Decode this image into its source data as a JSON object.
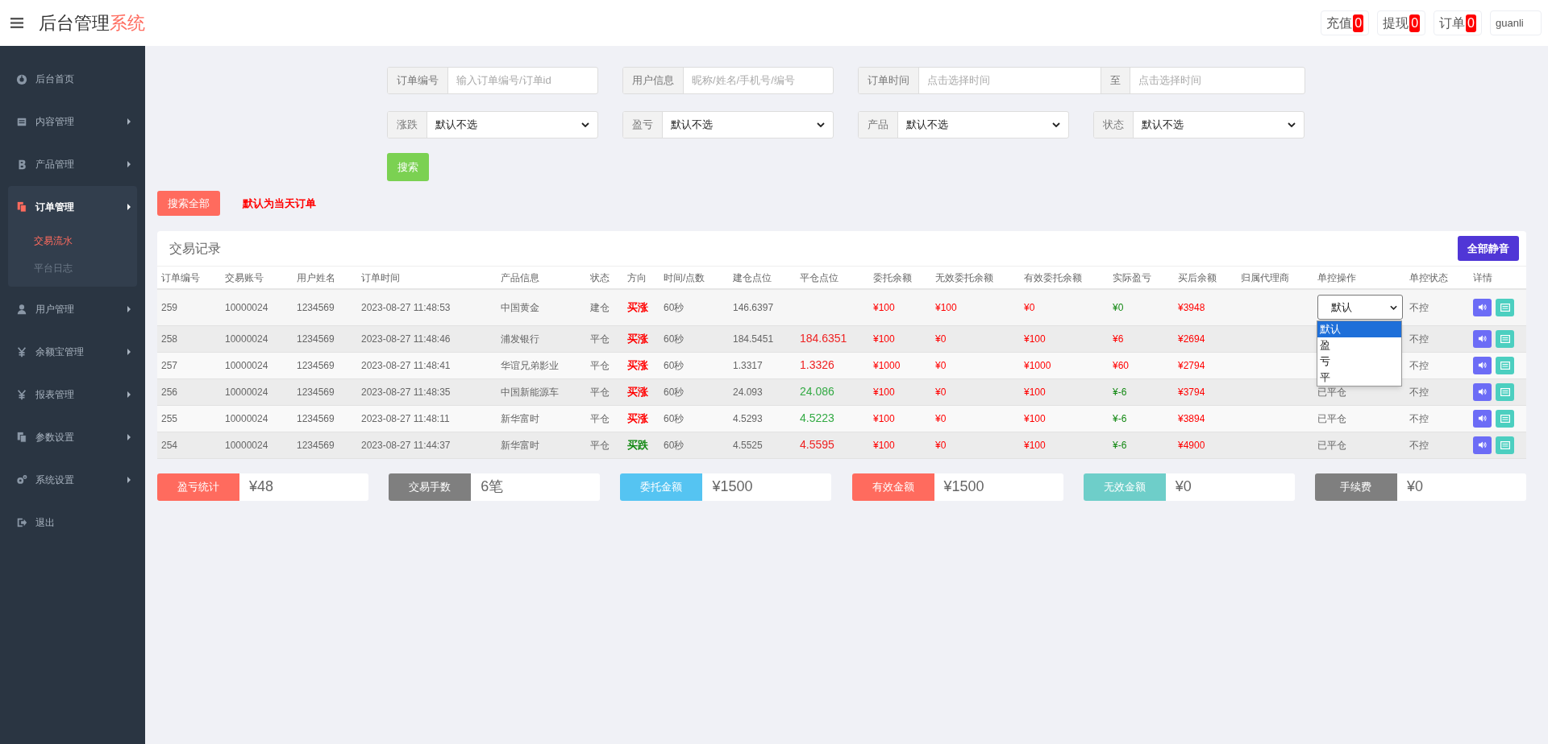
{
  "header": {
    "title": "后台管理",
    "title_accent": "系统",
    "badges": [
      {
        "label": "充值",
        "count": "0"
      },
      {
        "label": "提现",
        "count": "0"
      },
      {
        "label": "订单",
        "count": "0"
      }
    ],
    "user": "guanli"
  },
  "sidebar": {
    "items": [
      {
        "label": "后台首页",
        "expandable": false,
        "expanded": false
      },
      {
        "label": "内容管理",
        "expandable": true,
        "expanded": false
      },
      {
        "label": "产品管理",
        "expandable": true,
        "expanded": false
      },
      {
        "label": "订单管理",
        "expandable": true,
        "expanded": true,
        "children": [
          {
            "label": "交易流水",
            "selected": true
          },
          {
            "label": "平台日志",
            "selected": false
          }
        ]
      },
      {
        "label": "用户管理",
        "expandable": true,
        "expanded": false
      },
      {
        "label": "余额宝管理",
        "expandable": true,
        "expanded": false
      },
      {
        "label": "报表管理",
        "expandable": true,
        "expanded": false
      },
      {
        "label": "参数设置",
        "expandable": true,
        "expanded": false
      },
      {
        "label": "系统设置",
        "expandable": true,
        "expanded": false
      },
      {
        "label": "退出",
        "expandable": false,
        "expanded": false
      }
    ]
  },
  "filters": {
    "text_fields": [
      {
        "label": "订单编号",
        "placeholder": "输入订单编号/订单id"
      },
      {
        "label": "用户信息",
        "placeholder": "昵称/姓名/手机号/编号"
      },
      {
        "label": "订单时间",
        "placeholder": "点击选择时间",
        "separator": "至",
        "placeholder_end": "点击选择时间"
      }
    ],
    "selects": [
      {
        "label": "涨跌",
        "value": "默认不选"
      },
      {
        "label": "盈亏",
        "value": "默认不选"
      },
      {
        "label": "产品",
        "value": "默认不选"
      },
      {
        "label": "状态",
        "value": "默认不选"
      }
    ],
    "search_button": "搜索"
  },
  "search_all_button": "搜索全部",
  "note": "默认为当天订单",
  "table": {
    "title": "交易记录",
    "mute_all_button": "全部静音",
    "columns": [
      "订单编号",
      "交易账号",
      "用户姓名",
      "订单时间",
      "产品信息",
      "状态",
      "方向",
      "时间/点数",
      "建仓点位",
      "平仓点位",
      "委托余额",
      "无效委托余额",
      "有效委托余额",
      "实际盈亏",
      "买后余额",
      "归属代理商",
      "单控操作",
      "单控状态",
      "详情"
    ],
    "rows": [
      {
        "id": "259",
        "account": "10000024",
        "user": "1234569",
        "time": "2023-08-27 11:48:53",
        "product": "中国黄金",
        "status": "建仓",
        "direction": {
          "text": "买涨",
          "color": "#ff0000"
        },
        "duration": "60秒",
        "open_price": "146.6397",
        "entrust": "¥100",
        "invalid": "¥100",
        "valid": "¥0",
        "pnl": {
          "text": "¥0",
          "color": "#118811"
        },
        "balance": "¥3948",
        "control": {
          "kind": "select",
          "value": "默认"
        },
        "control_state": "不控"
      },
      {
        "id": "258",
        "account": "10000024",
        "user": "1234569",
        "time": "2023-08-27 11:48:46",
        "product": "浦发银行",
        "status": "平仓",
        "direction": {
          "text": "买涨",
          "color": "#ff0000"
        },
        "duration": "60秒",
        "open_price": "184.5451",
        "close_price": {
          "text": "184.6351",
          "color": "#ee2222"
        },
        "entrust": "¥100",
        "invalid": "¥0",
        "valid": "¥100",
        "pnl": {
          "text": "¥6",
          "color": "#ff0000"
        },
        "balance": "¥2694",
        "control_state": "不控"
      },
      {
        "id": "257",
        "account": "10000024",
        "user": "1234569",
        "time": "2023-08-27 11:48:41",
        "product": "华谊兄弟影业",
        "status": "平仓",
        "direction": {
          "text": "买涨",
          "color": "#ff0000"
        },
        "duration": "60秒",
        "open_price": "1.3317",
        "close_price": {
          "text": "1.3326",
          "color": "#ee2222"
        },
        "entrust": "¥1000",
        "invalid": "¥0",
        "valid": "¥1000",
        "pnl": {
          "text": "¥60",
          "color": "#ff0000"
        },
        "balance": "¥2794",
        "control_state": "不控"
      },
      {
        "id": "256",
        "account": "10000024",
        "user": "1234569",
        "time": "2023-08-27 11:48:35",
        "product": "中国新能源车",
        "status": "平仓",
        "direction": {
          "text": "买涨",
          "color": "#ff0000"
        },
        "duration": "60秒",
        "open_price": "24.093",
        "close_price": {
          "text": "24.086",
          "color": "#33aa44"
        },
        "entrust": "¥100",
        "invalid": "¥0",
        "valid": "¥100",
        "pnl": {
          "text": "¥-6",
          "color": "#118811"
        },
        "balance": "¥3794",
        "control": {
          "kind": "text",
          "text": "已平仓"
        },
        "control_state": "不控"
      },
      {
        "id": "255",
        "account": "10000024",
        "user": "1234569",
        "time": "2023-08-27 11:48:11",
        "product": "新华富时",
        "status": "平仓",
        "direction": {
          "text": "买涨",
          "color": "#ff0000"
        },
        "duration": "60秒",
        "open_price": "4.5293",
        "close_price": {
          "text": "4.5223",
          "color": "#33aa44"
        },
        "entrust": "¥100",
        "invalid": "¥0",
        "valid": "¥100",
        "pnl": {
          "text": "¥-6",
          "color": "#118811"
        },
        "balance": "¥3894",
        "control": {
          "kind": "text",
          "text": "已平仓"
        },
        "control_state": "不控"
      },
      {
        "id": "254",
        "account": "10000024",
        "user": "1234569",
        "time": "2023-08-27 11:44:37",
        "product": "新华富时",
        "status": "平仓",
        "direction": {
          "text": "买跌",
          "color": "#118811"
        },
        "duration": "60秒",
        "open_price": "4.5525",
        "close_price": {
          "text": "4.5595",
          "color": "#ee2222"
        },
        "entrust": "¥100",
        "invalid": "¥0",
        "valid": "¥100",
        "pnl": {
          "text": "¥-6",
          "color": "#118811"
        },
        "balance": "¥4900",
        "control": {
          "kind": "text",
          "text": "已平仓"
        },
        "control_state": "不控"
      }
    ]
  },
  "control_dropdown": {
    "options": [
      {
        "label": "默认",
        "selected": true
      },
      {
        "label": "盈",
        "selected": false
      },
      {
        "label": "亏",
        "selected": false
      },
      {
        "label": "平",
        "selected": false
      }
    ]
  },
  "stats": [
    {
      "label": "盈亏统计",
      "value": "¥48",
      "color": "#ff6b5e"
    },
    {
      "label": "交易手数",
      "value": "6笔",
      "color": "#7f7f7f"
    },
    {
      "label": "委托金额",
      "value": "¥1500",
      "color": "#55c4f2"
    },
    {
      "label": "有效金额",
      "value": "¥1500",
      "color": "#ff6b5e"
    },
    {
      "label": "无效金额",
      "value": "¥0",
      "color": "#6ecec9"
    },
    {
      "label": "手续费",
      "value": "¥0",
      "color": "#7f7f7f"
    }
  ]
}
